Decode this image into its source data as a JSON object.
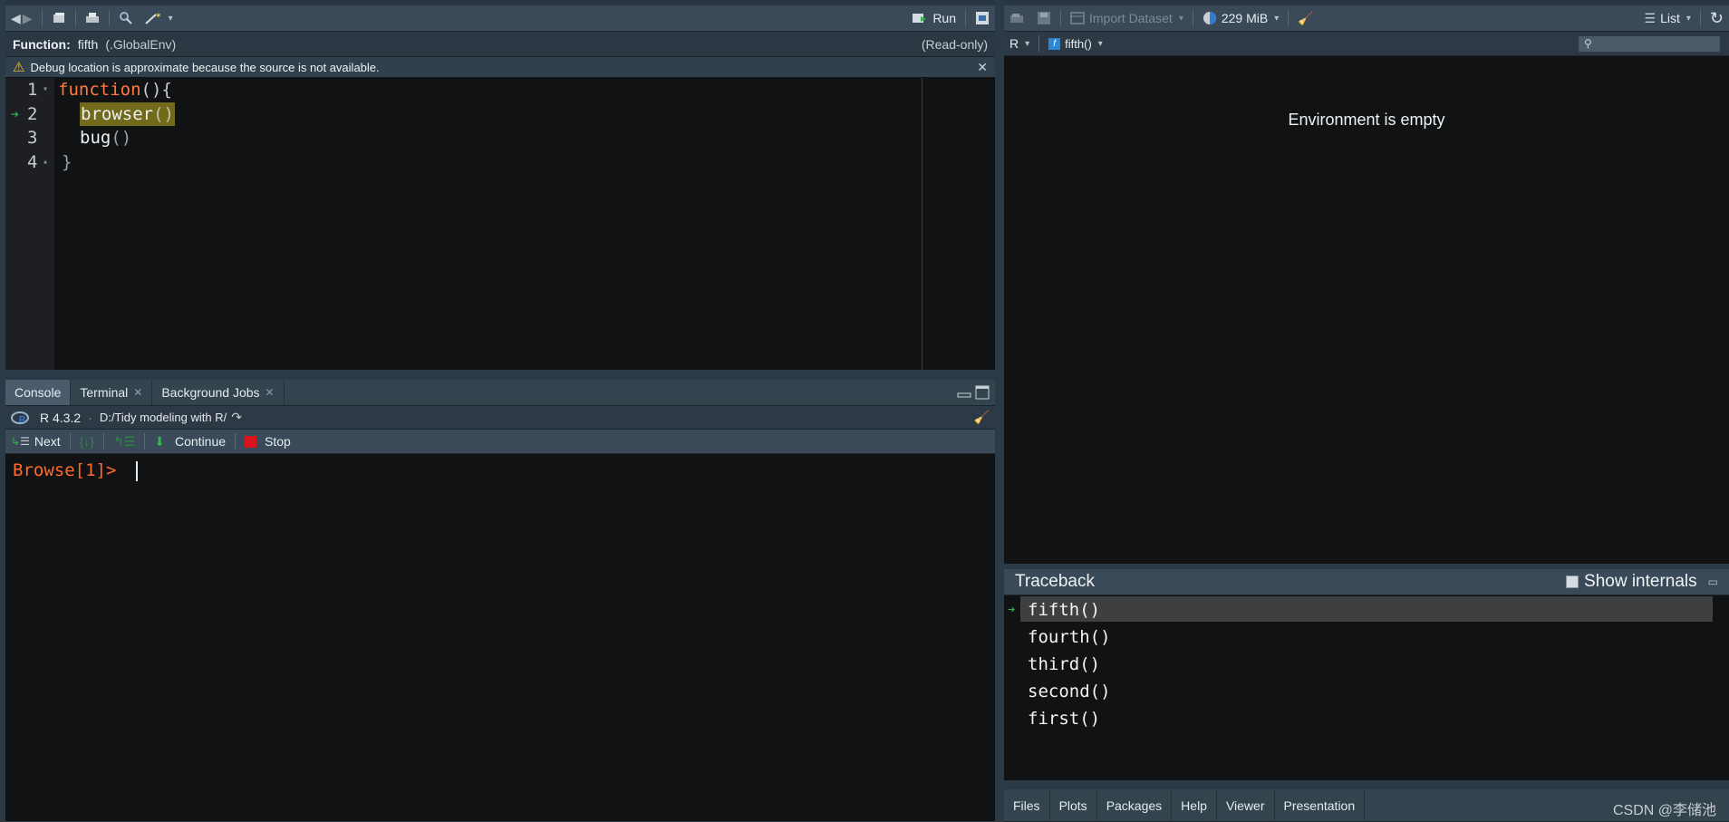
{
  "editor": {
    "toolbar": {
      "run_label": "Run"
    },
    "function_bar": {
      "prefix": "Function:",
      "name": "fifth",
      "env": "(.GlobalEnv)",
      "readonly": "(Read-only)"
    },
    "warning": {
      "text": "Debug location is approximate because the source is not available."
    },
    "lines": [
      {
        "num": "1",
        "code": "function(){"
      },
      {
        "num": "2",
        "code": "browser()"
      },
      {
        "num": "3",
        "code": "bug()"
      },
      {
        "num": "4",
        "code": "}"
      }
    ],
    "line1_kw": "function",
    "line1_rest": "(){",
    "line2_fn": "browser",
    "line2_paren": "()",
    "line3_fn": "bug",
    "line3_paren": "()",
    "line4": "}"
  },
  "console": {
    "tabs": [
      {
        "label": "Console"
      },
      {
        "label": "Terminal"
      },
      {
        "label": "Background Jobs"
      }
    ],
    "r_version": "R 4.3.2",
    "path": "D:/Tidy modeling with R/",
    "debug_toolbar": {
      "next": "Next",
      "continue": "Continue",
      "stop": "Stop"
    },
    "prompt": "Browse[1]>"
  },
  "environment": {
    "toolbar": {
      "import_dataset": "Import Dataset",
      "memory": "229 MiB",
      "view_mode": "List"
    },
    "language": "R",
    "frame": "fifth()",
    "empty_message": "Environment is empty"
  },
  "traceback": {
    "title": "Traceback",
    "show_internals": "Show internals",
    "frames": [
      "fifth()",
      "fourth()",
      "third()",
      "second()",
      "first()"
    ]
  },
  "files_tabs": [
    "Files",
    "Plots",
    "Packages",
    "Help",
    "Viewer",
    "Presentation"
  ],
  "watermark": "CSDN @李储池",
  "colors": {
    "keyword": "#ff7a3d",
    "prompt": "#ff6a2a",
    "highlight": "#706a1a",
    "debug_arrow": "#2fb64a"
  }
}
